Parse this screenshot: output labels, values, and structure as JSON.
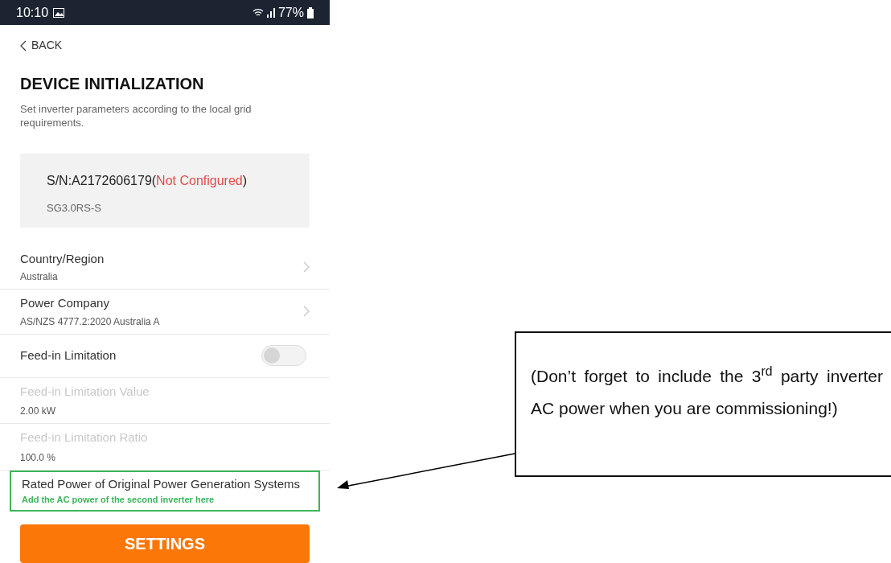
{
  "status_bar": {
    "time": "10:10",
    "battery": "77%"
  },
  "back": {
    "label": "BACK"
  },
  "title": "DEVICE INITIALIZATION",
  "description": "Set inverter parameters according to the local grid requirements.",
  "device": {
    "serial": "S/N:A2172606179(",
    "status": "Not Configured",
    "serial_end": ")",
    "model": "SG3.0RS-S"
  },
  "items": [
    {
      "kind": "nav",
      "label": "Country/Region",
      "value": "Australia",
      "disabled": false
    },
    {
      "kind": "nav",
      "label": "Power Company",
      "value": "AS/NZS 4777.2:2020 Australia A",
      "disabled": false
    },
    {
      "kind": "toggle",
      "label": "Feed-in Limitation",
      "on": false,
      "disabled": false
    },
    {
      "kind": "value",
      "label": "Feed-in Limitation Value",
      "value": "2.00 kW",
      "disabled": true
    },
    {
      "kind": "value",
      "label": "Feed-in Limitation Ratio",
      "value": "100.0 %",
      "disabled": true
    },
    {
      "kind": "highlight",
      "label": "Rated Power of Original Power Generation Systems",
      "hint": "Add the AC power of the second inverter here",
      "disabled": false
    }
  ],
  "settings_button": "SETTINGS",
  "callout": "(Don’t forget to include the 3$^{rd}$ party inverter AC power when you are commissioning!)"
}
